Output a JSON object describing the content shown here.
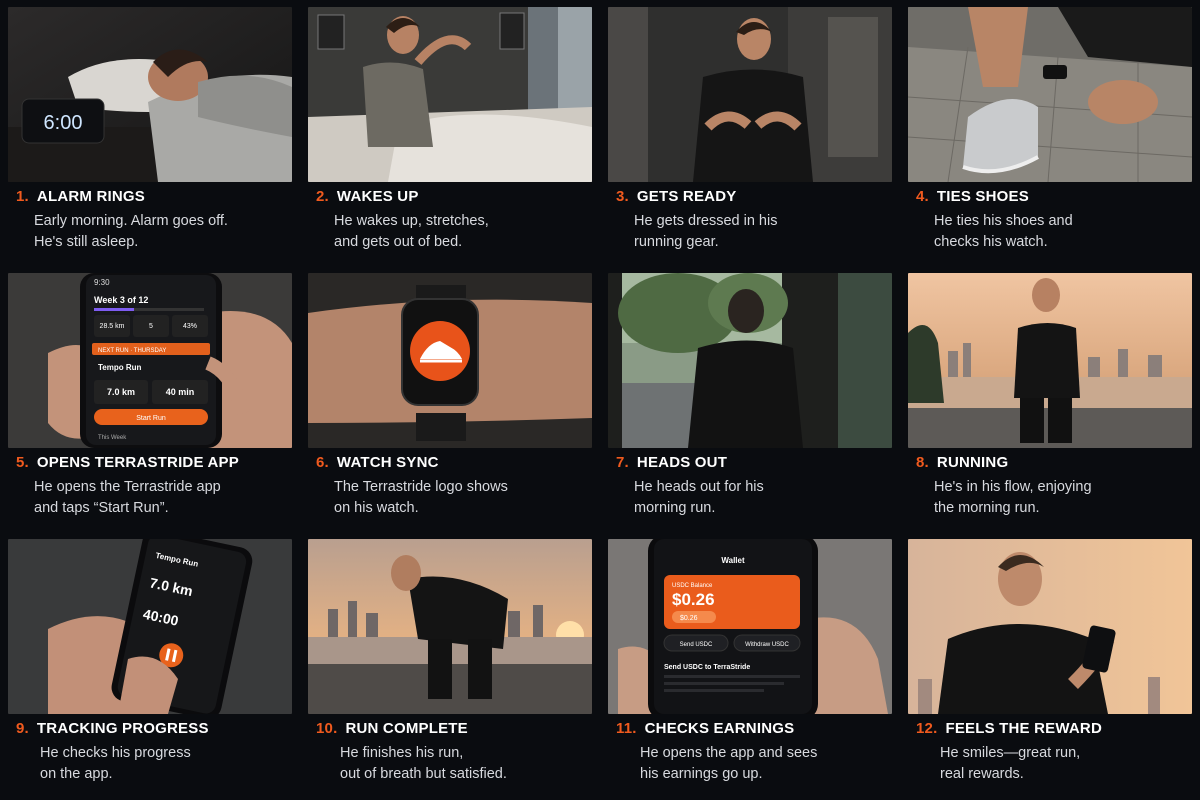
{
  "colors": {
    "background": "#0a0c10",
    "accent": "#f05a1e",
    "caption_text": "#d8dadf"
  },
  "steps": [
    {
      "number": "1.",
      "title": "ALARM RINGS",
      "description": "Early morning. Alarm goes off.\nHe's still asleep.",
      "clock": "6:00"
    },
    {
      "number": "2.",
      "title": "WAKES UP",
      "description": "He wakes up, stretches,\nand gets out of bed."
    },
    {
      "number": "3.",
      "title": "GETS READY",
      "description": "He gets dressed in his\nrunning gear."
    },
    {
      "number": "4.",
      "title": "TIES SHOES",
      "description": "He ties his shoes and\nchecks his watch."
    },
    {
      "number": "5.",
      "title": "OPENS TERRASTRIDE APP",
      "description": "He opens the Terrastride app\nand taps “Start Run”.",
      "phone": {
        "time": "9:30",
        "week": "Week 3 of 12",
        "stat_distance": "28.5 km",
        "stat_runs": "5",
        "stat_pct": "43%",
        "next_run": "NEXT RUN · THURSDAY",
        "run_name": "Tempo Run",
        "run_distance": "7.0 km",
        "run_time": "40 min",
        "start_button": "Start Run",
        "this_week": "This Week"
      }
    },
    {
      "number": "6.",
      "title": "WATCH SYNC",
      "description": "The Terrastride logo shows\non his watch.",
      "icon": "shoe-logo-icon"
    },
    {
      "number": "7.",
      "title": "HEADS OUT",
      "description": "He heads out for his\nmorning run."
    },
    {
      "number": "8.",
      "title": "RUNNING",
      "description": "He's in his flow, enjoying\nthe morning run."
    },
    {
      "number": "9.",
      "title": "TRACKING PROGRESS",
      "description": "He checks his progress\non the app.",
      "phone": {
        "run_name": "Tempo Run",
        "distance": "7.0 km",
        "time": "40:00"
      }
    },
    {
      "number": "10.",
      "title": "RUN COMPLETE",
      "description": "He finishes his run,\nout of breath but satisfied."
    },
    {
      "number": "11.",
      "title": "CHECKS EARNINGS",
      "description": "He opens the app and sees\nhis earnings go up.",
      "phone": {
        "header": "Wallet",
        "balance_label": "USDC Balance",
        "balance": "$0.26",
        "badge": "$0.26",
        "send_button": "Send USDC",
        "withdraw_button": "Withdraw USDC",
        "send_title": "Send USDC to TerraStride"
      }
    },
    {
      "number": "12.",
      "title": "FEELS THE REWARD",
      "description": "He smiles—great run,\nreal rewards."
    }
  ]
}
